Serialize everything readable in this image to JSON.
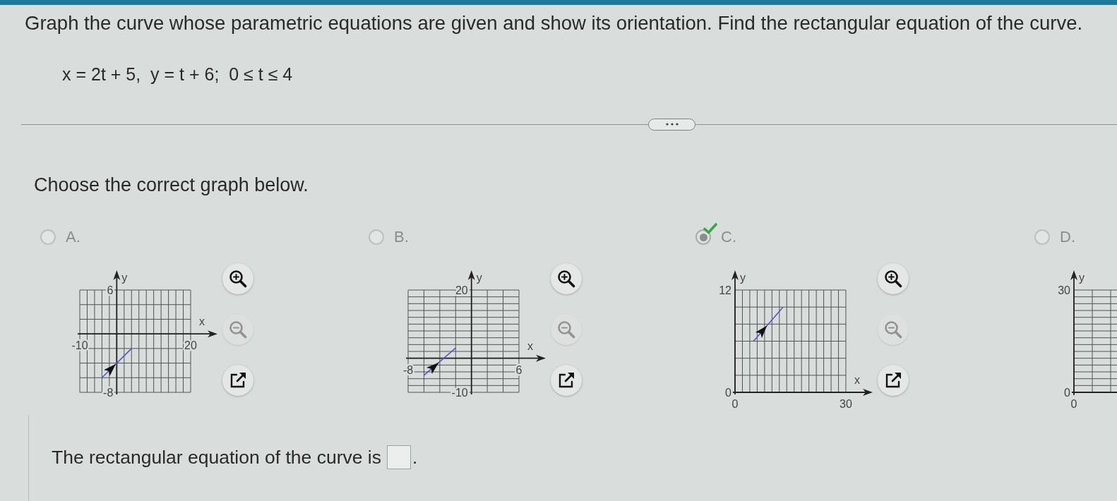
{
  "question": {
    "text": "Graph the curve whose parametric equations are given and show its orientation. Find the rectangular equation of the curve.",
    "equation": "x = 2t + 5,  y = t + 6;  0 ≤ t ≤ 4"
  },
  "prompt": "Choose the correct graph below.",
  "options": [
    {
      "label": "A.",
      "selected": false,
      "correct": false,
      "chart_data": {
        "type": "line",
        "xlabel": "x",
        "ylabel": "y",
        "xlim": [
          -10,
          20
        ],
        "ylim": [
          -8,
          6
        ],
        "xticks": [
          -10,
          20
        ],
        "yticks": [
          -8,
          6
        ],
        "x": [
          -4,
          4
        ],
        "series": [
          {
            "color": "#5656c8",
            "values": [
              -6,
              -2
            ]
          }
        ]
      },
      "tools": [
        {
          "kind": "zoom_in",
          "disabled": false
        },
        {
          "kind": "zoom_out",
          "disabled": true
        },
        {
          "kind": "new_window",
          "disabled": false
        }
      ]
    },
    {
      "label": "B.",
      "selected": false,
      "correct": false,
      "chart_data": {
        "type": "line",
        "xlabel": "x",
        "ylabel": "y",
        "xlim": [
          -8,
          6
        ],
        "ylim": [
          -10,
          20
        ],
        "xticks": [
          -8,
          6
        ],
        "yticks": [
          -10,
          20
        ],
        "x": [
          -6,
          -2
        ],
        "series": [
          {
            "color": "#5656c8",
            "values": [
              -5,
              3
            ]
          }
        ]
      },
      "tools": [
        {
          "kind": "zoom_in",
          "disabled": false
        },
        {
          "kind": "zoom_out",
          "disabled": true
        },
        {
          "kind": "new_window",
          "disabled": false
        }
      ]
    },
    {
      "label": "C.",
      "selected": true,
      "correct": true,
      "chart_data": {
        "type": "line",
        "xlabel": "x",
        "ylabel": "y",
        "xlim": [
          0,
          30
        ],
        "ylim": [
          0,
          12
        ],
        "xticks": [
          0,
          30
        ],
        "yticks": [
          0,
          12
        ],
        "x": [
          5,
          13
        ],
        "series": [
          {
            "color": "#5656c8",
            "values": [
              6,
              10
            ]
          }
        ]
      },
      "tools": [
        {
          "kind": "zoom_in",
          "disabled": false
        },
        {
          "kind": "zoom_out",
          "disabled": true
        },
        {
          "kind": "new_window",
          "disabled": false
        }
      ]
    },
    {
      "label": "D.",
      "selected": false,
      "correct": false,
      "graph": {
        "ylabel": "y",
        "y_tick_labels": [
          "30",
          "0"
        ],
        "x_tick_labels": [
          "0"
        ]
      }
    }
  ],
  "answer": {
    "text": "The rectangular equation of the curve is",
    "end": "."
  }
}
